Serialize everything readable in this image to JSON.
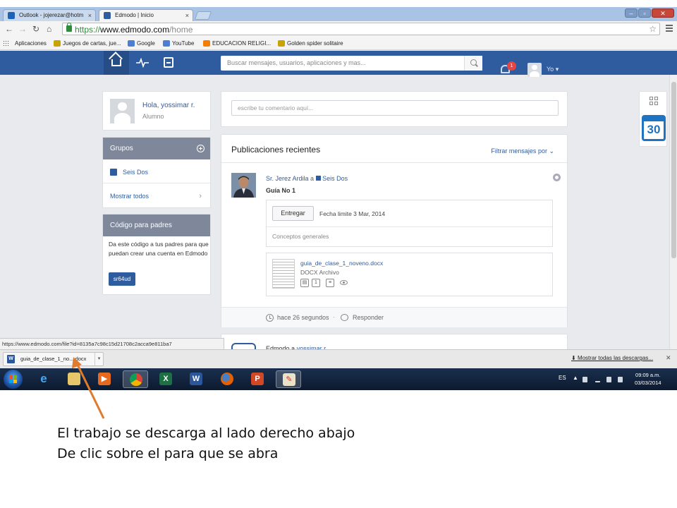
{
  "browser": {
    "tabs": [
      {
        "title": "Outlook - jojerezar@hotm",
        "icon": "outlook-icon",
        "state": "inactive"
      },
      {
        "title": "Edmodo | Inicio",
        "icon": "edmodo-favicon",
        "state": "active"
      }
    ],
    "close_glyph": "×",
    "url": {
      "scheme": "https://",
      "domain": "www.edmodo.com",
      "path": "/home"
    },
    "bookmarks": [
      {
        "label": "Aplicaciones",
        "icon": "apps-grid-icon"
      },
      {
        "label": "Juegos de cartas, jue...",
        "icon": "games-icon"
      },
      {
        "label": "Google",
        "icon": "google-icon"
      },
      {
        "label": "YouTube",
        "icon": "youtube-icon"
      },
      {
        "label": "EDUCACION RELIGI...",
        "icon": "blogger-icon"
      },
      {
        "label": "Golden spider solitaire",
        "icon": "games-icon"
      }
    ]
  },
  "edmodo": {
    "search_placeholder": "Buscar mensajes, usuarios, aplicaciones y mas...",
    "notifications_count": "1",
    "user_menu_label": "Yo",
    "profile": {
      "greeting": "Hola, yossimar r.",
      "role": "Alumno"
    },
    "groups": {
      "title": "Grupos",
      "items": [
        {
          "name": "Seis Dos"
        }
      ],
      "show_all": "Mostrar todos"
    },
    "parent_code": {
      "title": "Código para padres",
      "text": "Da este código a tus padres para que puedan crear una cuenta en Edmodo",
      "code": "sr64ud"
    },
    "comment_placeholder": "escribe tu comentario aquí...",
    "feed": {
      "title": "Publicaciones recientes",
      "filter_label": "Filtrar mensajes por",
      "post": {
        "author": "Sr. Jerez Ardila",
        "connector": "a",
        "group": "Seis Dos",
        "title": "Guía No 1",
        "submit_label": "Entregar",
        "due": "Fecha limite 3 Mar, 2014",
        "description": "Conceptos generales",
        "attachment": {
          "name": "guia_de_clase_1_noveno.docx",
          "type": "DOCX Archivo",
          "count": "1"
        },
        "time_ago": "hace 26 segundos",
        "separator": "·",
        "reply_label": "Responder"
      },
      "post2": {
        "author": "Edmodo",
        "connector": "a",
        "recipient": "yossimar r."
      }
    },
    "calendar_day": "30",
    "colors": {
      "brand": "#2f5c9e",
      "calendar": "#1e74c2",
      "badge": "#e64545"
    }
  },
  "status_url": "https://www.edmodo.com/file?id=8135a7c98c15d21708c2acca9e811ba7",
  "download": {
    "file_label": "guia_de_clase_1_no....docx",
    "show_all": "Mostrar todas las descargas..."
  },
  "taskbar": {
    "apps": [
      "internet-explorer",
      "file-explorer",
      "media-player",
      "chrome",
      "excel",
      "word",
      "firefox",
      "powerpoint",
      "paint"
    ],
    "language": "ES",
    "time": "09:09 a.m.",
    "date": "03/03/2014"
  },
  "instructions": [
    "El trabajo se descarga al lado derecho abajo",
    "De clic sobre el para que se abra"
  ]
}
